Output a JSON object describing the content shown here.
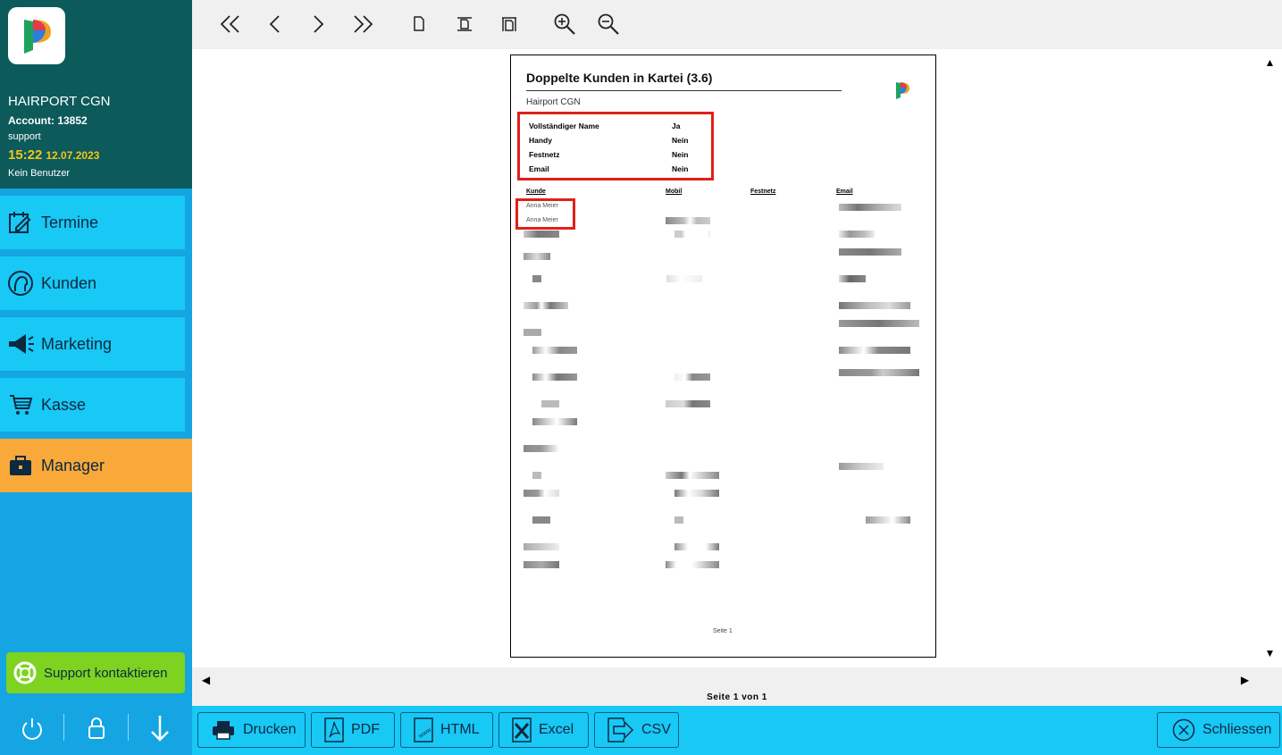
{
  "brand": {
    "salon": "HAIRPORT CGN",
    "account": "Account: 13852",
    "user": "support",
    "time": "15:22",
    "date": "12.07.2023",
    "no_user": "Kein Benutzer"
  },
  "nav": {
    "termine": "Termine",
    "kunden": "Kunden",
    "marketing": "Marketing",
    "kasse": "Kasse",
    "manager": "Manager",
    "active": "Manager"
  },
  "support": {
    "label": "Support kontaktieren"
  },
  "report": {
    "title": "Doppelte Kunden in Kartei (3.6)",
    "salon": "Hairport CGN",
    "criteria": [
      {
        "label": "Vollständiger Name",
        "value": "Ja"
      },
      {
        "label": "Handy",
        "value": "Nein"
      },
      {
        "label": "Festnetz",
        "value": "Nein"
      },
      {
        "label": "Email",
        "value": "Nein"
      }
    ],
    "columns": [
      "Kunde",
      "Mobil",
      "Festnetz",
      "Email"
    ],
    "duplicates": [
      "Anna Meier",
      "Anna Meier"
    ],
    "page_footer": "Seite 1"
  },
  "pager": {
    "label": "Seite 1 von 1"
  },
  "actions": {
    "print": "Drucken",
    "pdf": "PDF",
    "html": "HTML",
    "excel": "Excel",
    "csv": "CSV",
    "close": "Schliessen"
  },
  "colors": {
    "sidebar": "#14a5e2",
    "brand_bg": "#0d5a5b",
    "nav_item": "#18c8f5",
    "nav_active": "#f9a93a",
    "support": "#7ed321",
    "highlight": "#e0201a",
    "time": "#f5c518"
  }
}
